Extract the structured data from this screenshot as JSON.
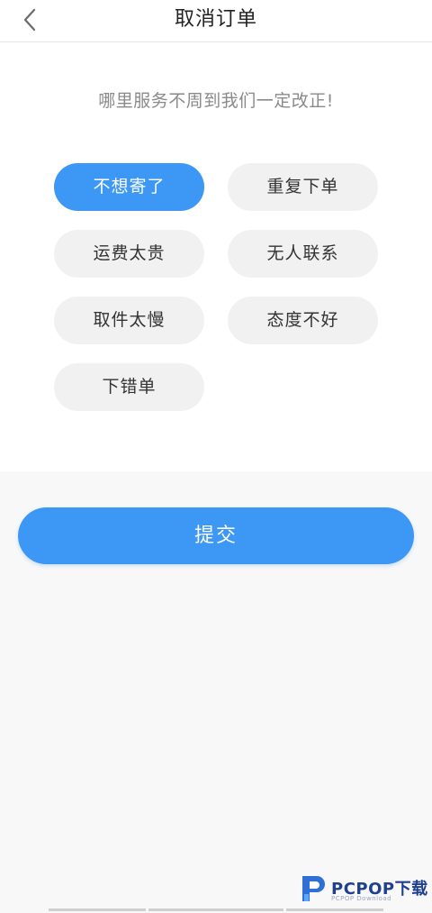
{
  "header": {
    "title": "取消订单",
    "back_icon": "chevron-left-icon"
  },
  "prompt": "哪里服务不周到我们一定改正!",
  "reasons": [
    {
      "label": "不想寄了",
      "selected": true
    },
    {
      "label": "重复下单",
      "selected": false
    },
    {
      "label": "运费太贵",
      "selected": false
    },
    {
      "label": "无人联系",
      "selected": false
    },
    {
      "label": "取件太慢",
      "selected": false
    },
    {
      "label": "态度不好",
      "selected": false
    },
    {
      "label": "下错单",
      "selected": false
    }
  ],
  "submit_label": "提交",
  "watermark": {
    "brand": "PCPOP下载",
    "sub": "PCPOP Download"
  },
  "colors": {
    "accent": "#3d97f5",
    "chip_bg": "#f1f1f1",
    "page_bg": "#f8f8f8"
  }
}
